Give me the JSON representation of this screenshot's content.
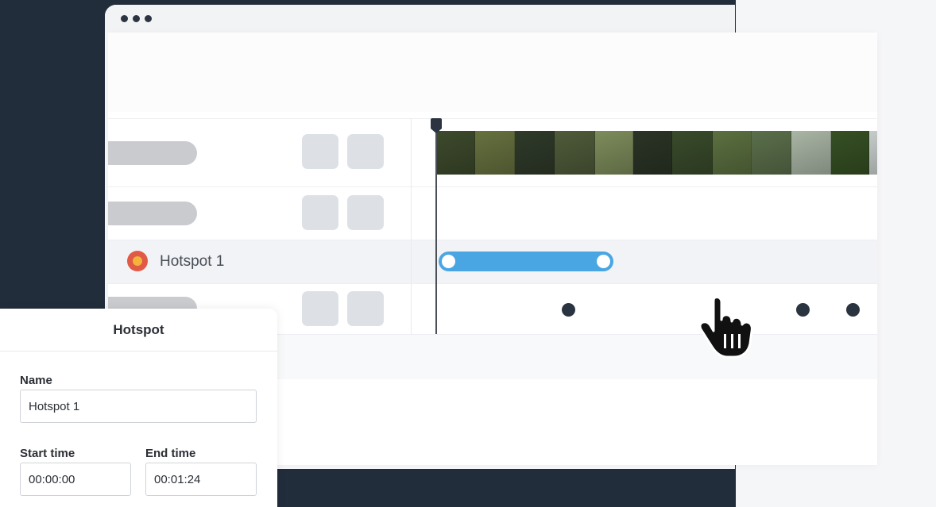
{
  "window": {
    "controls": [
      "dot",
      "dot",
      "dot"
    ]
  },
  "timeline": {
    "tracks": [
      {
        "type": "video",
        "label": ""
      },
      {
        "type": "blank",
        "label": ""
      },
      {
        "type": "hotspot",
        "label": "Hotspot 1"
      },
      {
        "type": "blank",
        "label": ""
      }
    ],
    "filmstrip_colors": [
      "#3d4a2c",
      "#66713f",
      "#2f3a2a",
      "#4f5b3a",
      "#7d8c5b",
      "#2b3426",
      "#394b2b",
      "#5b7040",
      "#5b6f4b",
      "#a9b5a5",
      "#365024",
      "#c5ccc9",
      "#6b6b44",
      "#445330"
    ],
    "clip": {
      "color": "#4aa6e3"
    },
    "keyframe_color": "#2a3440"
  },
  "hotspot_panel": {
    "title": "Hotspot",
    "name_label": "Name",
    "name_value": "Hotspot 1",
    "start_label": "Start time",
    "start_value": "00:00:00",
    "end_label": "End time",
    "end_value": "00:01:24"
  },
  "colors": {
    "dark_background": "#212d3b",
    "accent_blue": "#4aa6e3",
    "hotspot_red": "#e05a46",
    "hotspot_yellow": "#f2b43b"
  },
  "icons": [
    "window-dots-icon",
    "hotspot-icon",
    "playhead-icon",
    "hand-cursor-icon"
  ]
}
